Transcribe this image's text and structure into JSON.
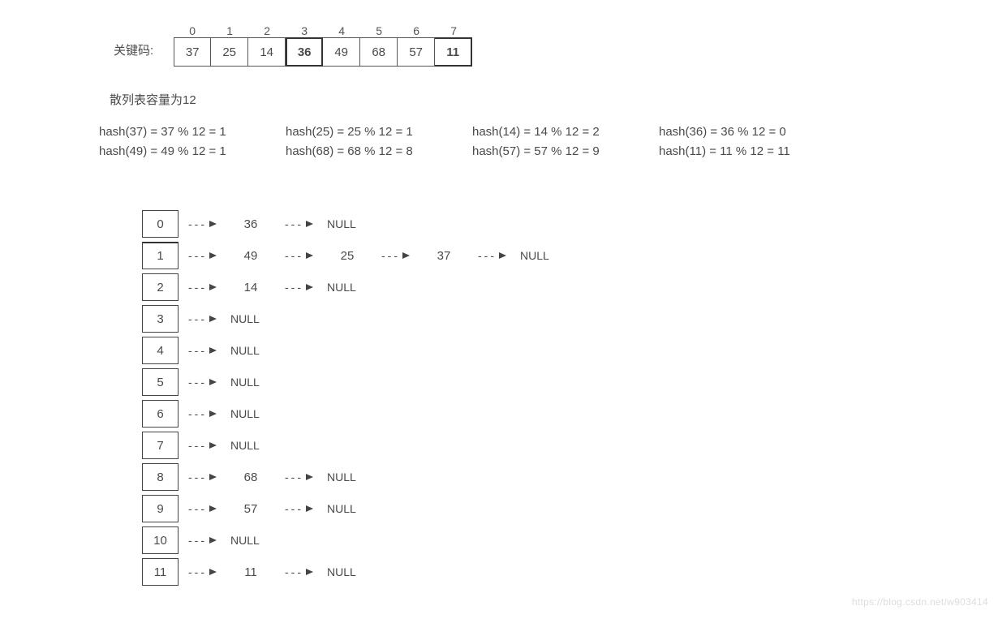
{
  "labels": {
    "keycode": "关键码:",
    "capacity": "散列表容量为12",
    "null": "NULL",
    "watermark": "https://blog.csdn.net/w903414"
  },
  "key_array": {
    "indices": [
      "0",
      "1",
      "2",
      "3",
      "4",
      "5",
      "6",
      "7"
    ],
    "values": [
      "37",
      "25",
      "14",
      "36",
      "49",
      "68",
      "57",
      "11"
    ]
  },
  "hash_calcs": [
    [
      "hash(37) = 37 % 12 = 1",
      "hash(25) = 25 % 12 = 1",
      "hash(14) = 14 % 12 = 2",
      "hash(36) = 36 % 12 = 0"
    ],
    [
      "hash(49) = 49 % 12 = 1",
      "hash(68) = 68 % 12 = 8",
      "hash(57) = 57 % 12 = 9",
      "hash(11) = 11 % 12 = 11"
    ]
  ],
  "buckets": [
    {
      "idx": "0",
      "chain": [
        "36",
        "NULL"
      ]
    },
    {
      "idx": "1",
      "chain": [
        "49",
        "25",
        "37",
        "NULL"
      ]
    },
    {
      "idx": "2",
      "chain": [
        "14",
        "NULL"
      ]
    },
    {
      "idx": "3",
      "chain": [
        "NULL"
      ]
    },
    {
      "idx": "4",
      "chain": [
        "NULL"
      ]
    },
    {
      "idx": "5",
      "chain": [
        "NULL"
      ]
    },
    {
      "idx": "6",
      "chain": [
        "NULL"
      ]
    },
    {
      "idx": "7",
      "chain": [
        "NULL"
      ]
    },
    {
      "idx": "8",
      "chain": [
        "68",
        "NULL"
      ]
    },
    {
      "idx": "9",
      "chain": [
        "57",
        "NULL"
      ]
    },
    {
      "idx": "10",
      "chain": [
        "NULL"
      ]
    },
    {
      "idx": "11",
      "chain": [
        "11",
        "NULL"
      ]
    }
  ],
  "chart_data": {
    "type": "table",
    "title": "Hash Table (Separate Chaining), capacity 12",
    "keys": [
      37,
      25,
      14,
      36,
      49,
      68,
      57,
      11
    ],
    "table_size": 12,
    "hash_function": "key % 12",
    "buckets": {
      "0": [
        36
      ],
      "1": [
        49,
        25,
        37
      ],
      "2": [
        14
      ],
      "3": [],
      "4": [],
      "5": [],
      "6": [],
      "7": [],
      "8": [
        68
      ],
      "9": [
        57
      ],
      "10": [],
      "11": [
        11
      ]
    }
  }
}
